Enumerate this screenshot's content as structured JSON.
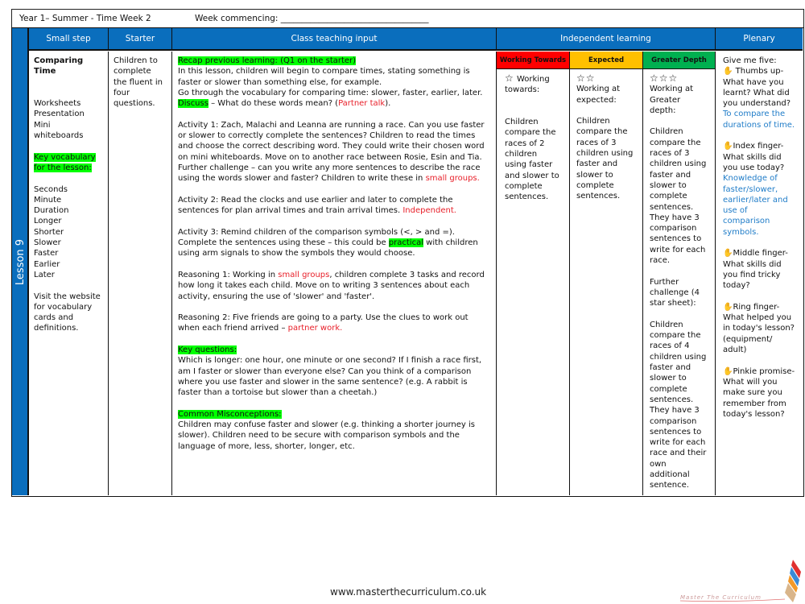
{
  "header": {
    "title": "Year 1– Summer - Time Week 2",
    "week_commencing": "Week commencing: ___________________________________"
  },
  "lesson": {
    "label": "Lesson 9"
  },
  "columns": {
    "small_step": "Small step",
    "starter": "Starter",
    "class_teaching": "Class teaching input",
    "independent": "Independent learning",
    "plenary": "Plenary"
  },
  "small_step": {
    "title": "Comparing Time",
    "resources": [
      "Worksheets",
      "Presentation",
      "Mini",
      "whiteboards"
    ],
    "vocab_heading": "Key vocabulary for the lesson:",
    "vocab": [
      "Seconds",
      "Minute",
      "Duration",
      "Longer",
      "Shorter",
      "Slower",
      "Faster",
      "Earlier",
      "Later"
    ],
    "website_note": "Visit the website for vocabulary cards and definitions."
  },
  "starter": {
    "text": "Children to complete the fluent in four questions."
  },
  "teaching": {
    "recap": "Recap previous learning: (Q1 on the starter)",
    "intro1": "In this lesson, children will begin to compare times, stating something is faster or slower than something else, for example.",
    "intro2": "Go through the vocabulary for comparing time: slower, faster, earlier, later.",
    "discuss_hl": "Discuss",
    "discuss_text": " – What do these words mean? (",
    "discuss_red": "Partner talk",
    "discuss_end": ").",
    "activity1": "Activity 1: Zach, Malachi and Leanna are running a race. Can you use faster or slower to correctly complete the sentences? Children to read the times and choose the correct describing word. They could write their chosen word on mini whiteboards. Move on to another race between Rosie, Esin and Tia.",
    "activity1_challenge": "Further challenge – can you write any more sentences to describe the race using the words slower and faster? Children to write these in ",
    "activity1_red": "small groups.",
    "activity2": "Activity 2: Read the clocks and use earlier and later to complete the sentences for plan arrival times and train arrival times. ",
    "activity2_red": "Independent.",
    "activity3_a": "Activity 3: Remind children of the comparison symbols (<, > and =). Complete the sentences using these – this could be ",
    "activity3_hl": "practical",
    "activity3_b": " with children using arm signals to show the symbols they would choose.",
    "reasoning1_a": "Reasoning 1: Working in ",
    "reasoning1_red": "small groups",
    "reasoning1_b": ", children complete 3 tasks and record how long it takes each child. Move on to writing 3 sentences about each activity, ensuring the use of 'slower' and 'faster'.",
    "reasoning2_a": "Reasoning 2: Five friends are going to a party. Use the clues to work out when each friend arrived – ",
    "reasoning2_red": "partner work.",
    "key_questions_heading": "Key questions:",
    "key_questions": "Which is longer: one hour, one minute or one second? If I finish a race first, am I faster or slower than everyone else? Can you think of a comparison where you use faster and slower in the same sentence? (e.g. A rabbit is faster than a tortoise but slower than a cheetah.)",
    "misconceptions_heading": "Common Misconceptions:",
    "misconceptions": "Children may confuse faster and slower (e.g. thinking a shorter journey is slower). Children need to be secure with comparison symbols and the language of more, less, shorter, longer, etc."
  },
  "independent": {
    "working_towards": {
      "label": "Working Towards",
      "color": "#ff0000",
      "stars": "☆",
      "heading": "Working towards:",
      "text": "Children compare the races of 2 children using faster and slower to complete sentences."
    },
    "expected": {
      "label": "Expected",
      "color": "#ffc000",
      "stars": "☆☆",
      "heading": "Working at expected:",
      "text": "Children compare the races of 3 children using faster and slower to complete sentences."
    },
    "greater_depth": {
      "label": "Greater Depth",
      "color": "#00b050",
      "stars": "☆☆☆",
      "heading": "Working at Greater depth:",
      "text": "Children compare the races of 3 children using faster and slower to complete sentences. They have 3 comparison sentences to write for each race.",
      "challenge_heading": "Further challenge (4 star sheet):",
      "challenge_text": "Children compare the races of 4 children using faster and slower to complete sentences. They have 3 comparison sentences to write for each race and their own additional sentence."
    }
  },
  "plenary": {
    "intro": "Give me five:",
    "items": [
      {
        "icon": "thumb",
        "text": "Thumbs up- What have you learnt? What did you understand?",
        "answer": "To compare the durations of time."
      },
      {
        "icon": "index",
        "text": "Index finger- What skills did you use today?",
        "answer": "Knowledge of faster/slower, earlier/later and use of comparison symbols."
      },
      {
        "icon": "middle",
        "text": "Middle finger- What skills did you find tricky today?",
        "answer": ""
      },
      {
        "icon": "ring",
        "text": "Ring finger- What helped you in today's lesson? (equipment/ adult)",
        "answer": ""
      },
      {
        "icon": "pinkie",
        "text": "Pinkie promise- What will you make sure you remember from today's lesson?",
        "answer": ""
      }
    ]
  },
  "footer": {
    "url": "www.masterthecurriculum.co.uk",
    "logo_text": "Master The Curriculum"
  }
}
